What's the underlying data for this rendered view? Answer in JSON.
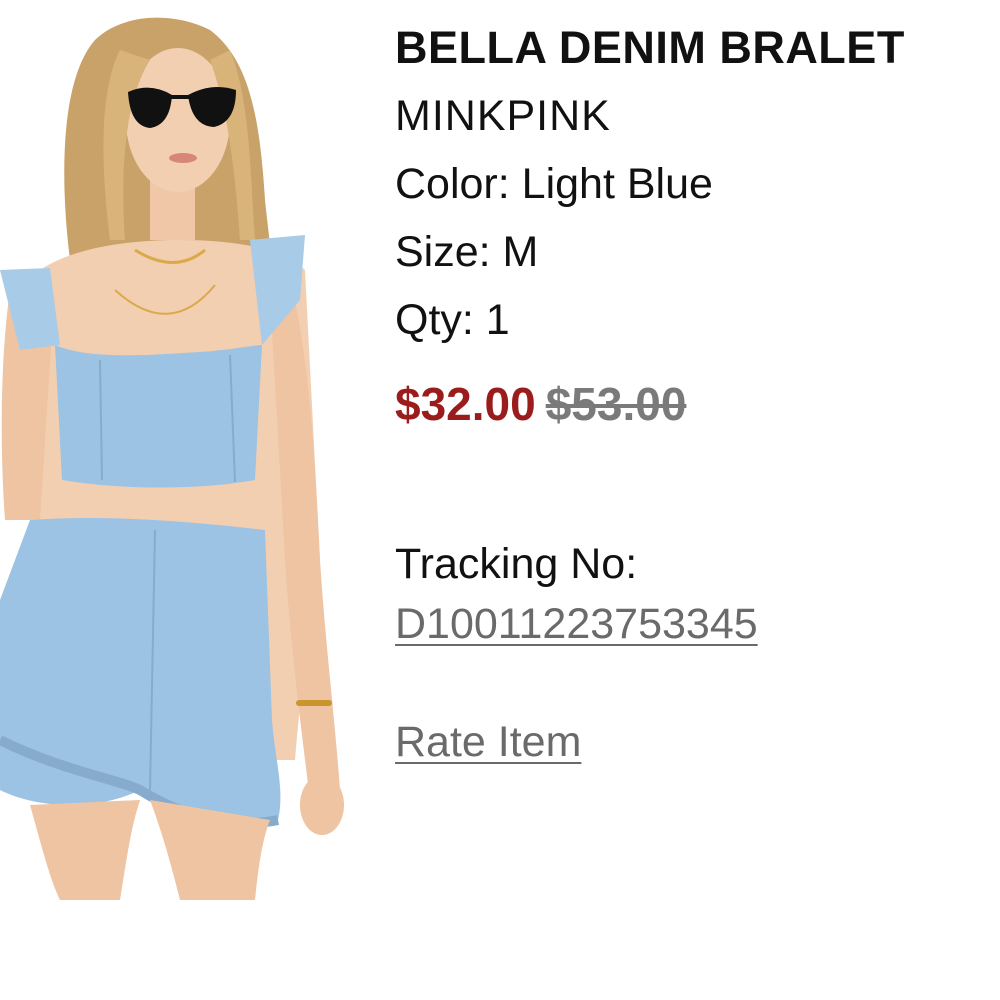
{
  "product": {
    "title": "BELLA DENIM BRALET",
    "brand": "MINKPINK",
    "color_line": "Color: Light Blue",
    "size_line": "Size: M",
    "qty_line": "Qty: 1"
  },
  "pricing": {
    "sale_price": "$32.00",
    "original_price": "$53.00"
  },
  "tracking": {
    "label": "Tracking No:",
    "number": "D10011223753345"
  },
  "actions": {
    "rate_item": "Rate Item"
  },
  "colors": {
    "sale_price": "#9b1c1c",
    "original_price": "#7a7a7a",
    "link": "#6a6a6a",
    "denim": "#9cc3e4"
  }
}
